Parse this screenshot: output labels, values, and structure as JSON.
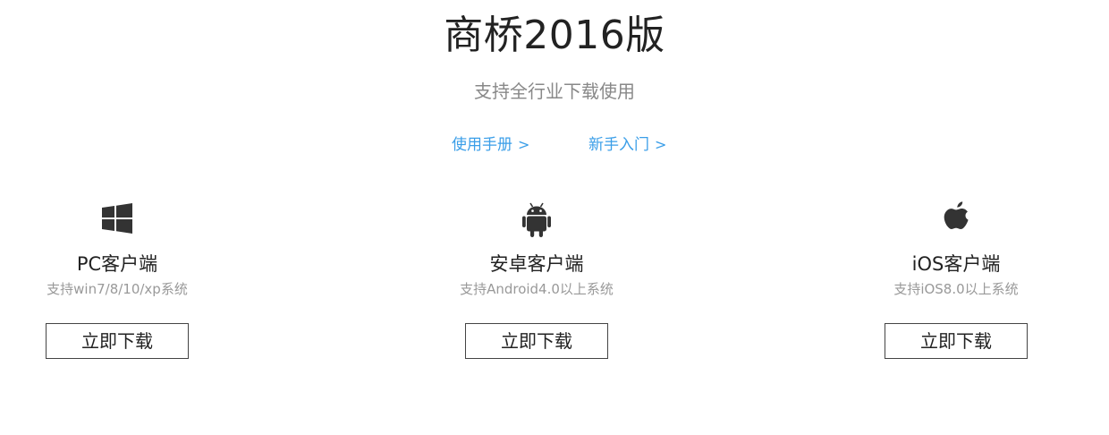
{
  "header": {
    "title": "商桥2016版",
    "subtitle": "支持全行业下载使用"
  },
  "links": [
    {
      "label": "使用手册",
      "arrow": ">"
    },
    {
      "label": "新手入门",
      "arrow": ">"
    }
  ],
  "clients": [
    {
      "icon": "windows-icon",
      "name": "PC客户端",
      "desc": "支持win7/8/10/xp系统",
      "button": "立即下载"
    },
    {
      "icon": "android-icon",
      "name": "安卓客户端",
      "desc": "支持Android4.0以上系统",
      "button": "立即下载"
    },
    {
      "icon": "apple-icon",
      "name": "iOS客户端",
      "desc": "支持iOS8.0以上系统",
      "button": "立即下载"
    }
  ],
  "colors": {
    "link": "#3a9ee8",
    "title": "#222222",
    "muted": "#888888",
    "icon": "#333333"
  }
}
